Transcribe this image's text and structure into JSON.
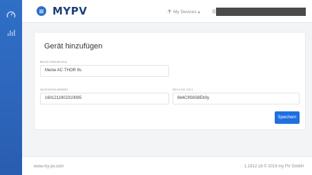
{
  "sidebar": {
    "items": [
      {
        "icon": "gauge-icon"
      },
      {
        "icon": "bar-chart-icon"
      }
    ],
    "color": "#2f6fc6"
  },
  "header": {
    "logo": "MYPV",
    "devices_menu": "My Devices",
    "language_menu": "",
    "user_menu": ""
  },
  "form": {
    "title": "Gerät hinzufügen",
    "fields": [
      {
        "label": "BESCHREIBUNG",
        "value": "Meine AC·THOR 9s"
      },
      {
        "label": "SERIENNUMMER",
        "value": "1601211902310085"
      },
      {
        "label": "DEVICE KEY",
        "value": "6b4C9S6S8Eb0y"
      }
    ],
    "save_label": "Speichern",
    "accent": "#1f6fe0"
  },
  "footer": {
    "left": "www.my-pv.com",
    "right": "1.1912.18 © 2019 my PV GmbH"
  }
}
